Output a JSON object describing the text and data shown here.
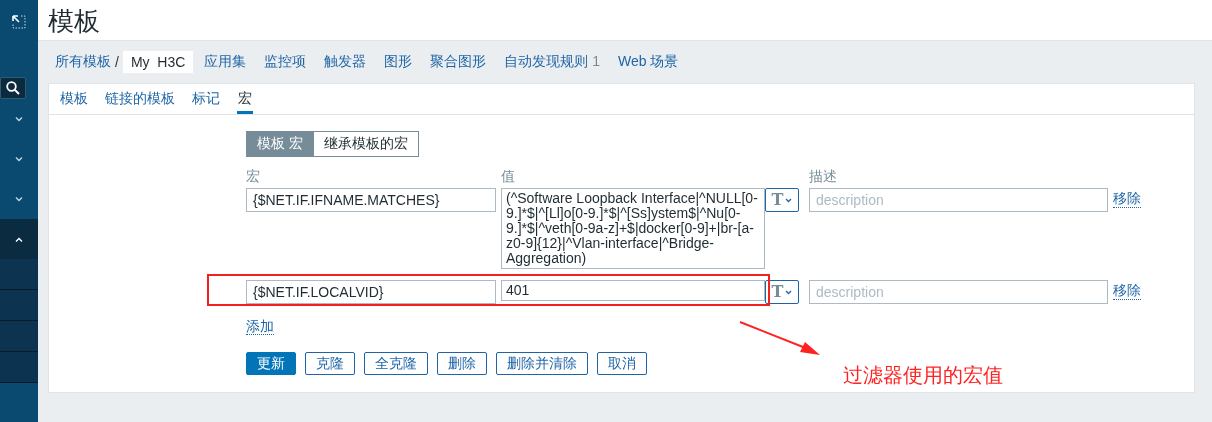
{
  "page_title": "模板",
  "breadcrumb": [
    {
      "label": "所有模板",
      "kind": "link"
    },
    {
      "label": "/",
      "kind": "separator"
    },
    {
      "label": "My  H3C",
      "kind": "current"
    }
  ],
  "nav_items": [
    {
      "label": "应用集"
    },
    {
      "label": "监控项"
    },
    {
      "label": "触发器"
    },
    {
      "label": "图形"
    },
    {
      "label": "聚合图形"
    },
    {
      "label": "自动发现规则",
      "count": "1"
    },
    {
      "label": "Web 场景"
    }
  ],
  "sidebar": {
    "sections": [
      {
        "expanded": false
      },
      {
        "expanded": false
      },
      {
        "expanded": false
      },
      {
        "expanded": true
      }
    ]
  },
  "tabs": [
    {
      "label": "模板",
      "selected": false
    },
    {
      "label": "链接的模板",
      "selected": false
    },
    {
      "label": "标记",
      "selected": false
    },
    {
      "label": "宏",
      "selected": true
    }
  ],
  "macro_view": [
    {
      "label": "模板 宏",
      "selected": true
    },
    {
      "label": "继承模板的宏",
      "selected": false
    }
  ],
  "columns": [
    "宏",
    "值",
    "描述"
  ],
  "macros": [
    {
      "macro": "{$NET.IF.IFNAME.MATCHES}",
      "value": "(^Software Loopback Interface|^NULL[0-9.]*$|^[Ll]o[0-9.]*$|^[Ss]ystem$|^Nu[0-9.]*$|^veth[0-9a-z]+$|docker[0-9]+|br-[a-z0-9]{12}|^Vlan-interface|^Bridge-Aggregation)",
      "type_symbol": "T",
      "description_placeholder": "description",
      "remove": "移除",
      "highlighted": false
    },
    {
      "macro": "{$NET.IF.LOCALVID}",
      "value": "401",
      "type_symbol": "T",
      "description_placeholder": "description",
      "remove": "移除",
      "highlighted": true
    }
  ],
  "add_link": "添加",
  "buttons": [
    {
      "label": "更新",
      "kind": "primary"
    },
    {
      "label": "克隆",
      "kind": "secondary"
    },
    {
      "label": "全克隆",
      "kind": "secondary"
    },
    {
      "label": "删除",
      "kind": "secondary"
    },
    {
      "label": "删除并清除",
      "kind": "secondary"
    },
    {
      "label": "取消",
      "kind": "secondary"
    }
  ],
  "annotation": {
    "text": "过滤器使用的宏值"
  }
}
